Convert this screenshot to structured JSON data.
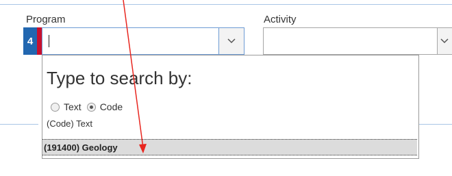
{
  "form": {
    "program_label": "Program",
    "activity_label": "Activity",
    "step_number": "4",
    "program_value": "",
    "activity_value": ""
  },
  "dropdown": {
    "title": "Type to search by:",
    "search_mode_options": [
      {
        "label": "Text",
        "selected": false
      },
      {
        "label": "Code",
        "selected": true
      }
    ],
    "format_hint": "(Code) Text",
    "results": [
      "(191400) Geology"
    ]
  },
  "icons": {
    "program_toggle": "chevron-down-icon",
    "activity_toggle": "chevron-down-icon"
  },
  "colors": {
    "step_badge": "#2267b0",
    "required_marker": "#c8102e",
    "annotation_arrow": "#e8261f",
    "highlight_row": "#dcdcdc"
  }
}
